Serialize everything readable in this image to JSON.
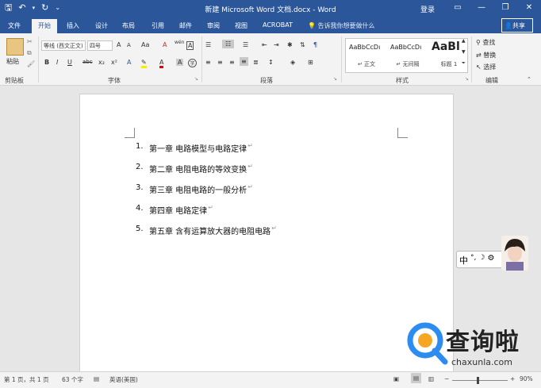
{
  "titlebar": {
    "title": "新建 Microsoft Word 文档.docx - Word",
    "login": "登录"
  },
  "tabs": {
    "file": "文件",
    "home": "开始",
    "insert": "插入",
    "design": "设计",
    "layout": "布局",
    "references": "引用",
    "mailings": "邮件",
    "review": "审阅",
    "view": "视图",
    "acrobat": "ACROBAT",
    "tellme": "告诉我你想要做什么",
    "share": "共享"
  },
  "ribbon": {
    "clipboard": {
      "paste": "粘贴",
      "label": "剪贴板"
    },
    "font": {
      "name": "等线 (西文正文)",
      "size": "四号",
      "label": "字体",
      "bold": "B",
      "italic": "I",
      "underline": "U",
      "strike": "abc",
      "sub": "x₂",
      "sup": "x²",
      "aa": "Aa",
      "fontcolor": "A",
      "charbox": "A",
      "big_a": "A",
      "small_a": "A",
      "wen": "wén",
      "a_clear": "A"
    },
    "paragraph": {
      "label": "段落"
    },
    "styles": {
      "label": "样式",
      "items": [
        {
          "sample": "AaBbCcDı",
          "name": "↵ 正文"
        },
        {
          "sample": "AaBbCcDı",
          "name": "↵ 无间隔"
        },
        {
          "sample": "AaBl",
          "name": "标题 1"
        }
      ]
    },
    "editing": {
      "label": "编辑",
      "find": "查找",
      "replace": "替换",
      "select": "选择"
    }
  },
  "document": {
    "items": [
      {
        "num": "1.",
        "text": "第一章  电路模型与电路定律"
      },
      {
        "num": "2.",
        "text": "第二章  电阻电路的等效变换"
      },
      {
        "num": "3.",
        "text": "第三章  电阻电路的一般分析"
      },
      {
        "num": "4.",
        "text": "第四章  电路定律"
      },
      {
        "num": "5.",
        "text": "第五章  含有运算放大器的电阻电路"
      }
    ],
    "para_mark": "↵"
  },
  "ime": {
    "mode": "中"
  },
  "watermark": {
    "brand": "查询啦",
    "domain": "chaxunla.com"
  },
  "status": {
    "page": "第 1 页，共 1 页",
    "words": "63 个字",
    "lang": "英语(美国)",
    "zoom": "90%"
  },
  "colors": {
    "brand": "#2b579a",
    "watermark": "#2d8cf0"
  }
}
